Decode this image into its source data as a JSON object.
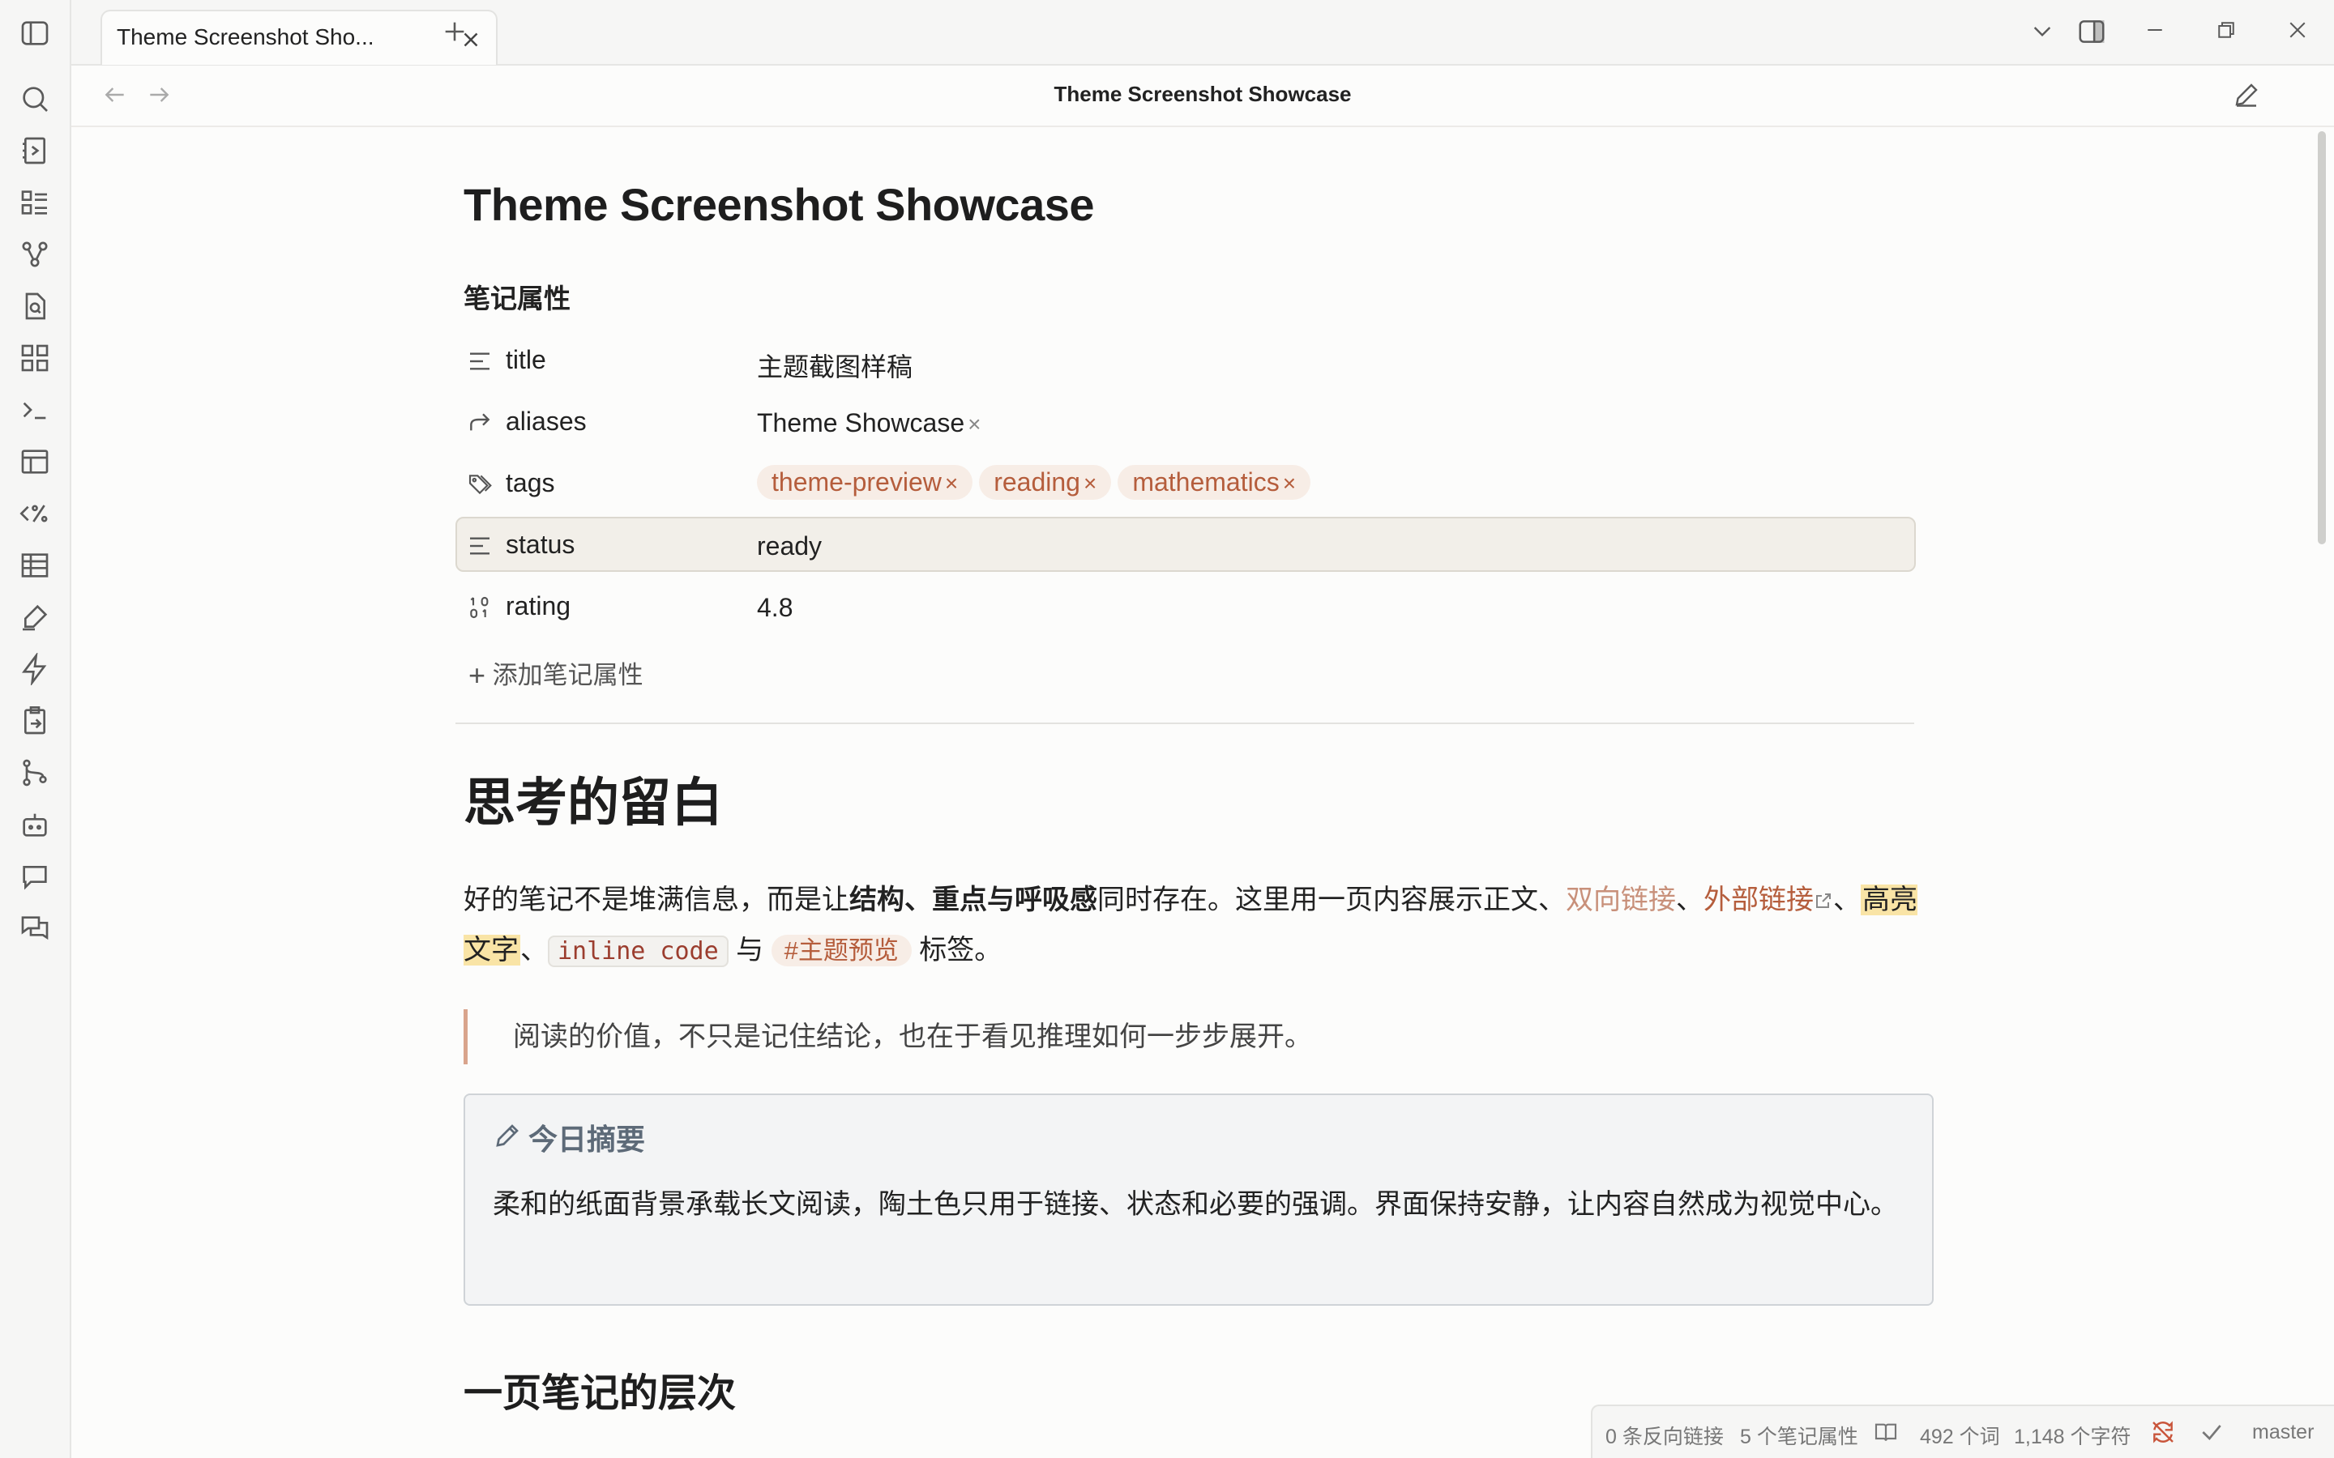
{
  "tab": {
    "title": "Theme Screenshot Sho..."
  },
  "header": {
    "title": "Theme Screenshot Showcase"
  },
  "note": {
    "title": "Theme Screenshot Showcase",
    "properties_heading": "笔记属性",
    "properties": [
      {
        "key": "title",
        "icon": "text-lines-icon",
        "value": "主题截图样稿"
      },
      {
        "key": "aliases",
        "icon": "forward-arrow-icon",
        "value": "Theme Showcase"
      },
      {
        "key": "tags",
        "icon": "tags-icon",
        "values": [
          "theme-preview",
          "reading",
          "mathematics"
        ]
      },
      {
        "key": "status",
        "icon": "text-lines-icon",
        "value": "ready"
      },
      {
        "key": "rating",
        "icon": "number-icon",
        "value": "4.8"
      }
    ],
    "add_property": "添加笔记属性",
    "heading1": "思考的留白",
    "paragraph": {
      "p1": "好的笔记不是堆满信息，而是让",
      "bold": "结构、重点与呼吸感",
      "p2": "同时存在。这里用一页内容展示正文、",
      "internal_link": "双向链接",
      "sep1": "、",
      "external_link": "外部链接",
      "sep2": "、",
      "highlight": "高亮文字",
      "sep3": "、",
      "code": "inline code",
      "and": " 与 ",
      "tag": "#主题预览",
      "p3": " 标签。"
    },
    "quote": "阅读的价值，不只是记住结论，也在于看见推理如何一步步展开。",
    "callout": {
      "title": "今日摘要",
      "body": "柔和的纸面背景承载长文阅读，陶土色只用于链接、状态和必要的强调。界面保持安静，让内容自然成为视觉中心。"
    },
    "heading2": "一页笔记的层次"
  },
  "status_bar": {
    "backlinks": "0 条反向链接",
    "properties": "5 个笔记属性",
    "words": "492 个词",
    "chars": "1,148 个字符",
    "branch": "master"
  },
  "colors": {
    "accent": "#b55d3c",
    "link_light": "#c8907a",
    "highlight": "#f9e4a6",
    "callout": "#5d6a78"
  }
}
